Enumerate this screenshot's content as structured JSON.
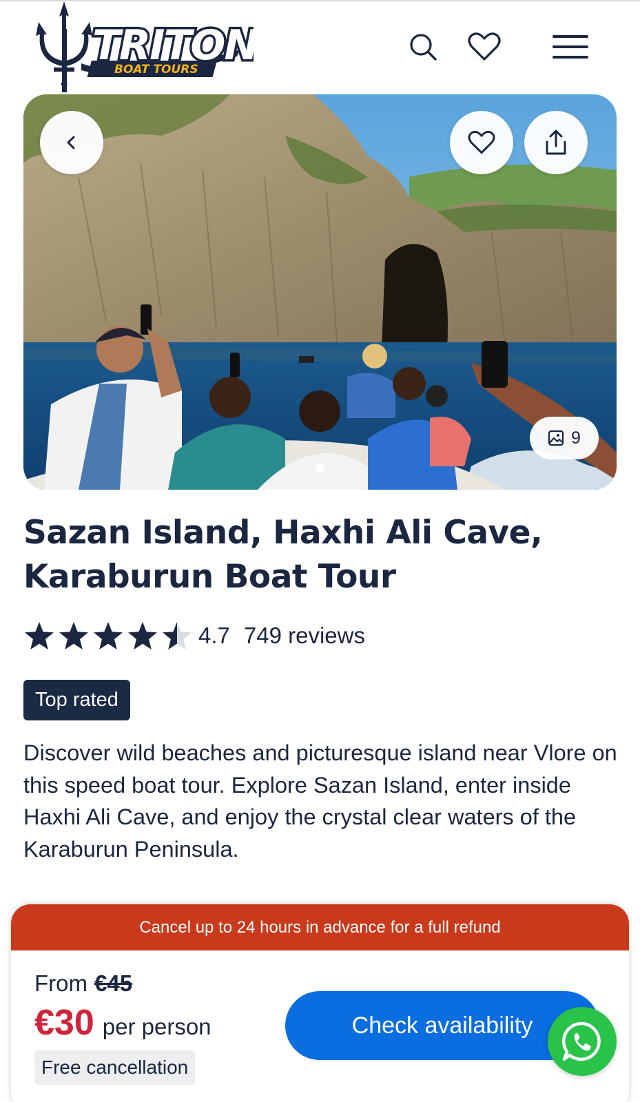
{
  "brand": {
    "name": "TRITON",
    "tagline": "BOAT TOURS"
  },
  "header": {
    "icons": [
      "search-icon",
      "heart-icon",
      "menu-icon"
    ]
  },
  "gallery": {
    "photo_count": "9",
    "icons": [
      "chevron-left-icon",
      "heart-icon",
      "share-icon",
      "image-icon"
    ]
  },
  "tour": {
    "title_line1": "Sazan Island, Haxhi Ali Cave,",
    "title_line2": "Karaburun Boat Tour",
    "rating": 4.7,
    "rating_text": "4.7",
    "reviews": "749 reviews",
    "badge": "Top rated",
    "description": "Discover wild beaches and picturesque island near Vlore on this speed boat tour. Explore Sazan Island, enter inside Haxhi Ali Cave, and enjoy the crystal clear waters of the Karaburun Peninsula."
  },
  "booking": {
    "cancel_notice": "Cancel up to 24 hours in advance for a full refund",
    "from_label": "From",
    "old_price": "€45",
    "price": "€30",
    "per_label": "per person",
    "free_cancellation": "Free cancellation",
    "cta": "Check availability"
  },
  "colors": {
    "navy": "#1b2640",
    "badge_bg": "#1b2a45",
    "cancel_bar": "#c9391b",
    "price_red": "#d0243a",
    "cta_blue": "#0a6de0",
    "whatsapp_green": "#29c34a",
    "logo_gold": "#f2b21c"
  }
}
